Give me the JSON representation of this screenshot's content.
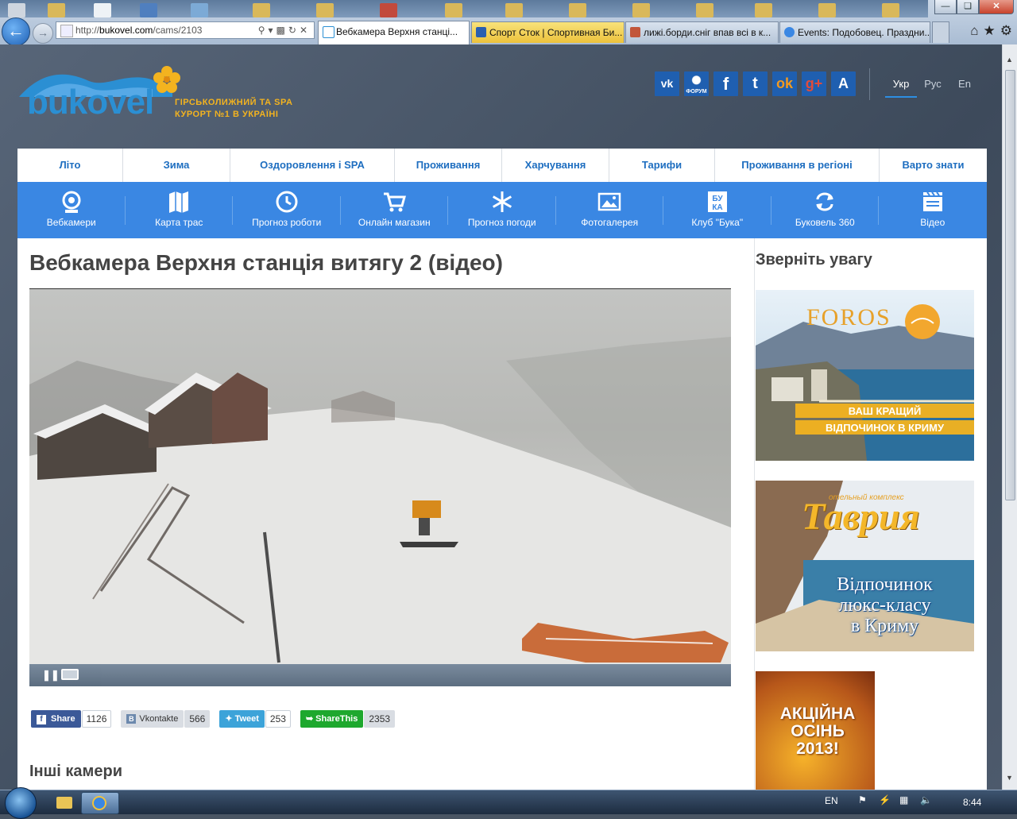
{
  "browser": {
    "address": "http://bukovel.com/cams/2103",
    "address_domain": "bukovel.com",
    "address_path": "/cams/2103",
    "tabs": [
      {
        "label": "Вебкамера Верхня станці...",
        "active": true
      },
      {
        "label": "Спорт Сток | Спортивная Би...",
        "active": false
      },
      {
        "label": "лижі.борди.сніг впав всі в к...",
        "active": false
      },
      {
        "label": "Events: Подобовец. Праздни...",
        "active": false
      }
    ]
  },
  "logo": {
    "text": "bukovel",
    "tagline1": "ГІРСЬКОЛИЖНИЙ ТА SPA",
    "tagline2": "КУРОРТ №1 В УКРАЇНІ"
  },
  "social": [
    {
      "icon": "vk-icon",
      "glyph": "vk"
    },
    {
      "icon": "forum-icon",
      "glyph": "ФОРУМ"
    },
    {
      "icon": "facebook-icon",
      "glyph": "f"
    },
    {
      "icon": "twitter-icon",
      "glyph": "t"
    },
    {
      "icon": "odnoklassniki-icon",
      "glyph": "ok"
    },
    {
      "icon": "googleplus-icon",
      "glyph": "g+"
    },
    {
      "icon": "appstore-icon",
      "glyph": "A"
    }
  ],
  "languages": [
    "Укр",
    "Рус",
    "En"
  ],
  "nav": [
    "Літо",
    "Зима",
    "Оздоровлення і SPA",
    "Проживання",
    "Харчування",
    "Тарифи",
    "Проживання в регіоні",
    "Варто знати"
  ],
  "bluebar": [
    {
      "label": "Вебкамери",
      "icon": "webcam-icon"
    },
    {
      "label": "Карта трас",
      "icon": "map-icon"
    },
    {
      "label": "Прогноз роботи",
      "icon": "clock-icon"
    },
    {
      "label": "Онлайн магазин",
      "icon": "cart-icon"
    },
    {
      "label": "Прогноз погоди",
      "icon": "snowflake-icon"
    },
    {
      "label": "Фотогалерея",
      "icon": "photo-icon"
    },
    {
      "label": "Клуб \"Бука\"",
      "icon": "buka-icon"
    },
    {
      "label": "Буковель 360",
      "icon": "rotate-icon"
    },
    {
      "label": "Відео",
      "icon": "video-icon"
    }
  ],
  "page_title": "Вебкамера Верхня станція витягу 2 (відео)",
  "share": [
    {
      "label": "Share",
      "count": "1126",
      "color": "#3b5998"
    },
    {
      "label": "Vkontakte",
      "count": "566",
      "color": "#d9dde3"
    },
    {
      "label": "Tweet",
      "count": "253",
      "color": "#3ca3d9"
    },
    {
      "label": "ShareThis",
      "count": "2353",
      "color": "#1ea82e"
    }
  ],
  "other_cameras": "Інші камери",
  "sidebar_title": "Зверніть увагу",
  "ads": {
    "foros_logo": "FOROS",
    "foros_line1": "ВАШ КРАЩИЙ",
    "foros_line2": "ВІДПОЧИНОК В КРИМУ",
    "tavria_small": "отельный комплекс",
    "tavria_logo": "Таврия",
    "tavria_line1": "Відпочинок",
    "tavria_line2": "люкс-класу",
    "tavria_line3": "в Криму",
    "autumn_line1": "АКЦІЙНА",
    "autumn_line2": "ОСІНЬ",
    "autumn_line3": "2013!"
  },
  "tray": {
    "lang": "EN",
    "time": "8:44"
  }
}
